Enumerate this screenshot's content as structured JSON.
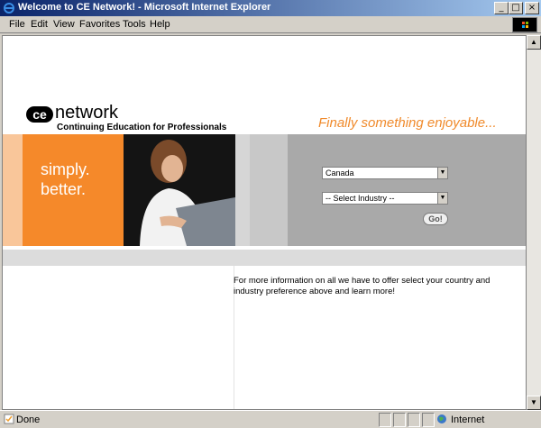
{
  "window": {
    "title": "Welcome to CE Network! - Microsoft Internet Explorer"
  },
  "menu": [
    {
      "label": "File"
    },
    {
      "label": "Edit"
    },
    {
      "label": "View"
    },
    {
      "label": "Favorites"
    },
    {
      "label": "Tools"
    },
    {
      "label": "Help"
    }
  ],
  "page": {
    "logo_mark": "ce",
    "logo_word": "network",
    "tagline": "Continuing Education for Professionals",
    "slogan": "Finally something enjoyable...",
    "simply": "simply.",
    "better": "better.",
    "country_select": "Canada",
    "industry_select": "-- Select Industry --",
    "go_label": "Go!",
    "info_text": "For more information on all we have to offer select your country and industry preference above and learn more!"
  },
  "status": {
    "text": "Done",
    "zone": "Internet"
  },
  "colors": {
    "accent_orange": "#f5892a",
    "slogan_orange": "#f08a2b",
    "band_gray": "#a9a9a9"
  }
}
